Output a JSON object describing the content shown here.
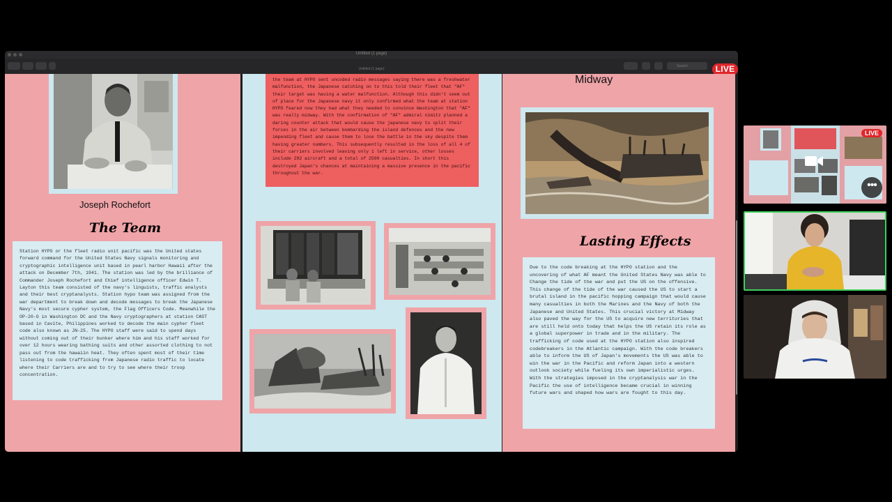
{
  "window": {
    "title": "Untitled (1 page)",
    "subtitle": "Untitled (1 page)",
    "search_placeholder": "Search",
    "live_badge": "LIVE"
  },
  "poster": {
    "left": {
      "portrait_caption": "Joseph Rochefort",
      "heading": "The Team",
      "body": "Station HYPO or the fleet radio unit pacific was the United states forward command for the United States Navy signals monitoring and cryptographic intelligence unit based in pearl harbor Hawaii after the attack on December 7th, 1941. The station was led by the brilliance of Commander Joseph Rochefort and Chief intelligence officer Edwin T. Layton this team consisted of the navy's linguists, traffic analysts and their best cryptanalysts. Station hypo team was assigned from the war department to break down and decode messages to break the Japanese Navy's most secure cypher system, the Flag Officers Code. Meanwhile the OP-20-G in Washington DC and the Navy cryptographers at station CAST based in Cavite, Philippines worked to decode the main cypher fleet code also known as JN-25. The HYPO staff were said to spend days without coming out of their bunker where him and his staff worked for over 12 hours wearing bathing suits and other assorted clothing to not pass out from the hawaiin heat. They often spent most of their time listening to code trafficking from Japanese radio traffic to locate where their Carriers are and to try to see where their troop concentration."
    },
    "middle": {
      "body": "the team at HYPO sent uncoded radio messages saying there was a freshwater malfunction, the Japanese catching on to this told their fleet that \"AF\" their target was having a water malfunction. Although this didn't seem out of place for the Japanese navy it only confirmed what the team at station HYPO feared now they had what they needed to convince Washington that \"AF\" was really midway. With the confirmation of \"AF\" admiral nimitz planned a daring counter attack that would cause the japanese navy to split their forces in the air between bombarding the island defences and the new impending fleet and cause them to lose the battle in the sky despite them having greater numbers. This subsequently resulted in the loss of all 4 of their carriers involved leaving only 1 left in service, other losses include 292 aircraft and a total of 2500 casualties. In short this destroyed Japan's chances at maintaining a massive presence in the pacific throughout the war."
    },
    "right": {
      "top_heading": "Midway",
      "heading": "Lasting Effects",
      "body": "Due to the code breaking at the HYPO station and the uncovering of what AF meant the United States Navy was able to Change the tide of the war and put the US on the offensive. This change of the tide of the war caused the US to start a brutal island in the pacific hopping campaign that would cause many casualties in both the Marines and the Navy of both the Japanese and United States. This crucial victory at Midway also paved the way for the US to acquire new territories that are still held onto today that helps the US retain its role as a global superpower in trade and in the military. The trafficking of code used at the HYPO station also inspired codebreakers in the Atlantic campaign. With the code breakers able to inform the US of Japan's movements the US was able to win the war in the Pacific and reform Japan into a western outlook society while fueling its own imperialistic urges. With the strategies imposed in the cryptanalysis war in the Pacific the use of intelligence became crucial in winning future wars and shaped how wars are fought to this day."
    }
  },
  "video_panel": {
    "screen_share_live": "LIVE",
    "more_label": "•••"
  },
  "colors": {
    "pink": "#efa4a8",
    "light_blue": "#cde8ef",
    "red_box": "#ee5f60",
    "live_red": "#e0262b",
    "active_speaker": "#3ed05a"
  }
}
